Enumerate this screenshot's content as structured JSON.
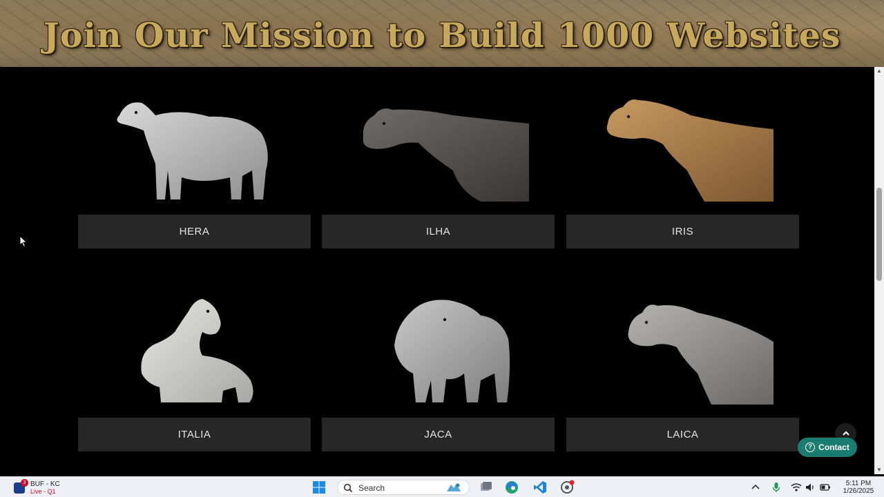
{
  "banner": {
    "title": "Join Our Mission to Build 1000 Websites"
  },
  "horses": [
    {
      "name": "HERA",
      "coat": "dapple-grey",
      "color": "#d9d9d9",
      "shade": "#8e8e8e"
    },
    {
      "name": "ILHA",
      "coat": "dark-dapple-grey",
      "color": "#6f6b69",
      "shade": "#3a3634"
    },
    {
      "name": "IRIS",
      "coat": "buckskin",
      "color": "#c89a62",
      "shade": "#7d5730"
    },
    {
      "name": "ITALIA",
      "coat": "white",
      "color": "#e6e6e3",
      "shade": "#a8a8a4"
    },
    {
      "name": "JACA",
      "coat": "dapple-grey",
      "color": "#c8c8c8",
      "shade": "#7e7e7e"
    },
    {
      "name": "LAICA",
      "coat": "light-grey",
      "color": "#b5b3b0",
      "shade": "#6a6866"
    }
  ],
  "floating": {
    "back_to_top_icon": "chevron-up-icon",
    "contact_label": "Contact",
    "contact_color": "#1a7d70"
  },
  "taskbar": {
    "widget": {
      "title": "BUF - KC",
      "subtitle": "Live - Q1",
      "badge": "3"
    },
    "search_placeholder": "Search",
    "time": "5:11 PM",
    "date": "1/26/2025"
  }
}
